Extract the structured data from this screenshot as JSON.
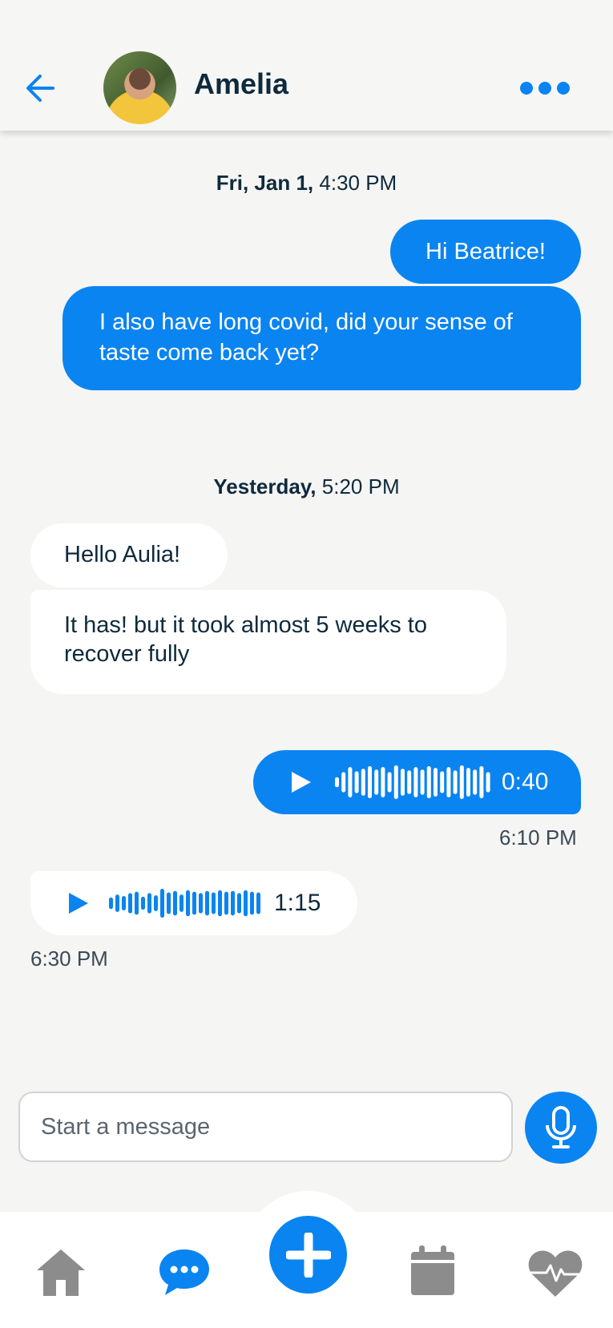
{
  "header": {
    "contact_name": "Amelia"
  },
  "thread": [
    {
      "kind": "date",
      "day": "Fri, Jan 1,",
      "time": "4:30 PM"
    },
    {
      "kind": "date",
      "day": "Yesterday,",
      "time": "5:20 PM"
    }
  ],
  "messages": {
    "m1": "Hi Beatrice!",
    "m2_line1": "I also have long covid, did your sense of",
    "m2_line2": "taste come back yet?",
    "m3": "Hello Aulia!",
    "m4_line1": "It has! but it took almost 5 weeks to",
    "m4_line2": "recover fully"
  },
  "voice": [
    {
      "duration": "0:40",
      "time": "6:10 PM",
      "direction": "outgoing"
    },
    {
      "duration": "1:15",
      "time": "6:30 PM",
      "direction": "incoming"
    }
  ],
  "composer": {
    "placeholder": "Start a message"
  },
  "tabs": [
    {
      "name": "home",
      "icon": "home-icon",
      "active": false
    },
    {
      "name": "messages",
      "icon": "chat-icon",
      "active": true
    },
    {
      "name": "add",
      "icon": "plus-icon",
      "active": false
    },
    {
      "name": "calendar",
      "icon": "calendar-icon",
      "active": false
    },
    {
      "name": "health",
      "icon": "heart-pulse-icon",
      "active": false
    }
  ],
  "colors": {
    "accent": "#0a84f0",
    "background": "#f5f5f4",
    "text": "#0e2a3c",
    "inactive_icon": "#8c8c8c"
  }
}
